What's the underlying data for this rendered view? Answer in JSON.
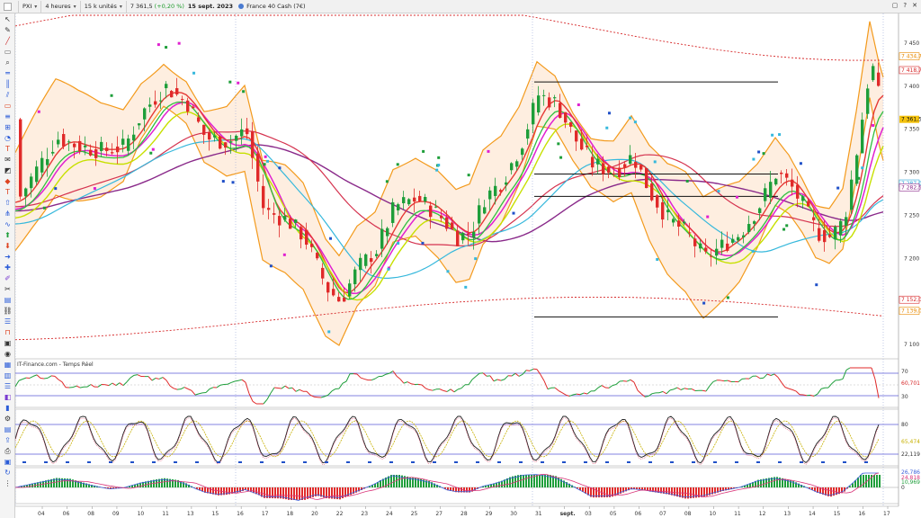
{
  "toolbar": {
    "symbol": "PXI",
    "period": "4 heures",
    "units": "15 k unités",
    "last_price": "7 361,5",
    "change": "(+0,20 %)",
    "date": "15 sept. 2023",
    "instrument": "France 40 Cash (7€)",
    "window_controls": [
      "restore-icon",
      "help-icon",
      "close-icon"
    ]
  },
  "chart": {
    "watermark": "IT-Finance.com - Temps Réel",
    "price_axis_ticks": [
      "7 450",
      "7 400",
      "7 350",
      "7 300",
      "7 250",
      "7 200",
      "7 150",
      "7 100"
    ],
    "price_tags": [
      {
        "label": "7 434,7",
        "color": "#e88a00"
      },
      {
        "label": "7 418,7",
        "color": "#d62728"
      },
      {
        "label": "7 361,5",
        "color": "#111111",
        "bg": "#f4c20d"
      },
      {
        "label": "7 287,0",
        "color": "#2aa6d8"
      },
      {
        "label": "7 282,5",
        "color": "#8b2a8b"
      },
      {
        "label": "7 152,0",
        "color": "#d62728"
      },
      {
        "label": "7 139,0",
        "color": "#e88a00"
      }
    ],
    "indicator_tags": {
      "rsi": [
        "70",
        "60,701",
        "30"
      ],
      "stoch": [
        "80",
        "65,474",
        "22,119"
      ],
      "macd": [
        "26,786",
        "24,818",
        "10,969",
        "0"
      ]
    },
    "x_axis_labels": [
      "04",
      "06",
      "08",
      "09",
      "10",
      "11",
      "13",
      "15",
      "16",
      "17",
      "18",
      "20",
      "22",
      "23",
      "24",
      "25",
      "27",
      "28",
      "29",
      "30",
      "31",
      "sept.",
      "03",
      "05",
      "06",
      "07",
      "08",
      "10",
      "11",
      "12",
      "13",
      "14",
      "15",
      "16",
      "17"
    ],
    "colors": {
      "bull": "#1e9e3a",
      "bear": "#e02a2a",
      "bollinger": "#f39a1c",
      "ema_fast": "#e53935",
      "ema_pink": "#e020d0",
      "ema_lime": "#c7e000",
      "ema_green": "#2fbf40",
      "sma_cyan": "#36b8dc",
      "sma_red": "#d5334f",
      "sma_purple": "#8a2a8a"
    }
  }
}
